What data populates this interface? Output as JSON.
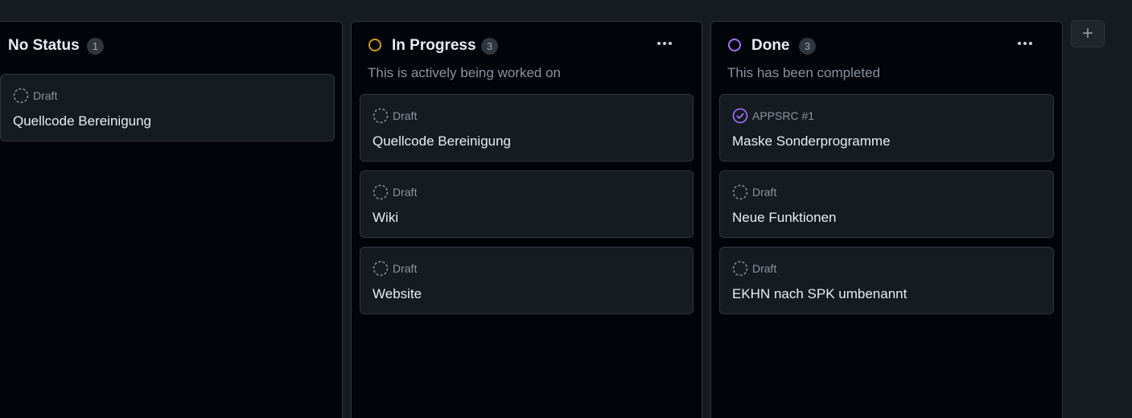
{
  "colors": {
    "in_progress_accent": "#d29922",
    "done_accent": "#a371f7",
    "draft_icon": "#8b949e"
  },
  "add_column_label": "+",
  "columns": [
    {
      "title": "No Status",
      "count": "1",
      "description": "",
      "cards": [
        {
          "icon": "draft-icon",
          "meta": "Draft",
          "title": "Quellcode Bereinigung"
        }
      ]
    },
    {
      "title": "In Progress",
      "count": "3",
      "description": "This is actively being worked on",
      "cards": [
        {
          "icon": "draft-icon",
          "meta": "Draft",
          "title": "Quellcode Bereinigung"
        },
        {
          "icon": "draft-icon",
          "meta": "Draft",
          "title": "Wiki"
        },
        {
          "icon": "draft-icon",
          "meta": "Draft",
          "title": "Website"
        }
      ]
    },
    {
      "title": "Done",
      "count": "3",
      "description": "This has been completed",
      "cards": [
        {
          "icon": "issue-closed-icon",
          "meta": "APPSRC #1",
          "title": "Maske Sonderprogramme"
        },
        {
          "icon": "draft-icon",
          "meta": "Draft",
          "title": "Neue Funktionen"
        },
        {
          "icon": "draft-icon",
          "meta": "Draft",
          "title": "EKHN nach SPK umbenannt"
        }
      ]
    }
  ]
}
